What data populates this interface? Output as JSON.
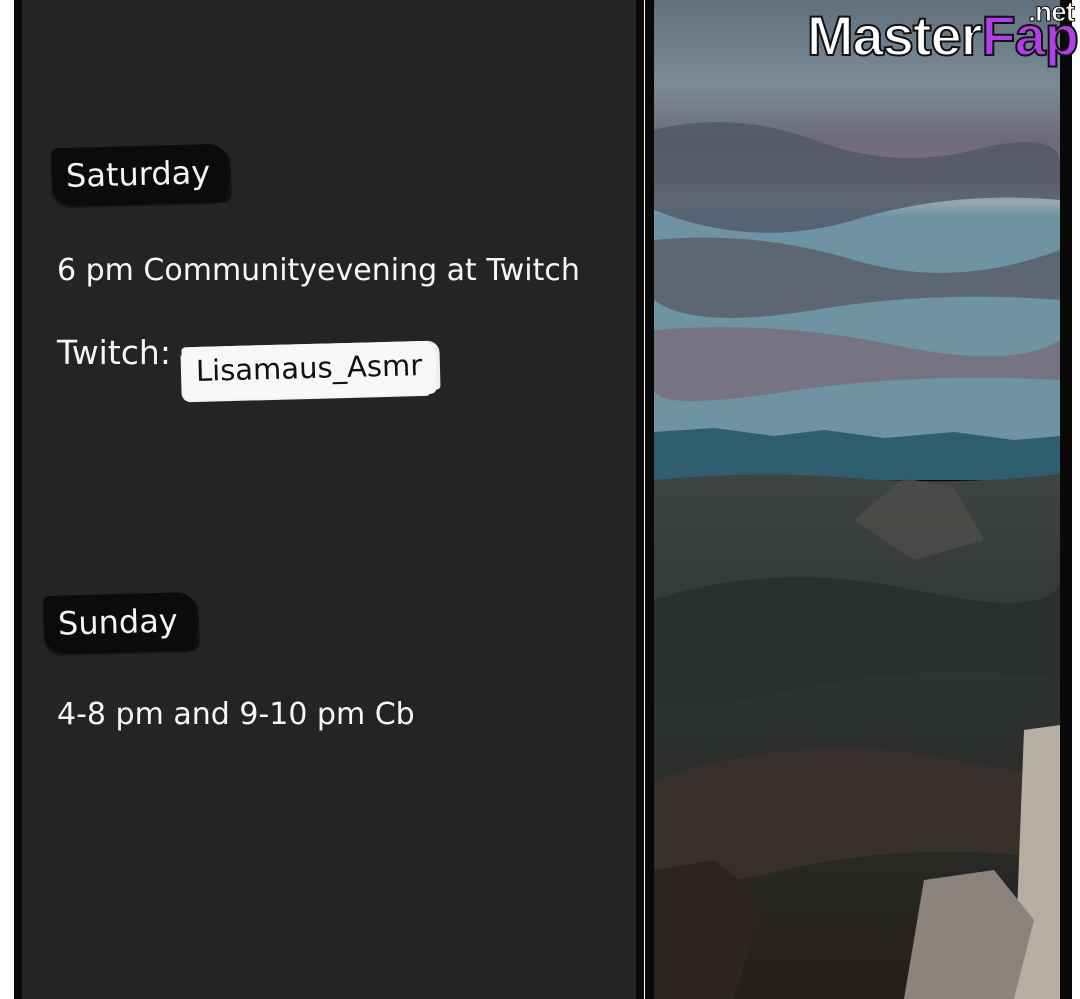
{
  "schedule": {
    "saturday": {
      "day_label": "Saturday",
      "event": "6 pm Communityevening at Twitch",
      "platform_label": "Twitch:",
      "handle": "Lisamaus_Asmr"
    },
    "sunday": {
      "day_label": "Sunday",
      "event": "4-8 pm and 9-10 pm Cb"
    }
  },
  "watermark": {
    "brand_part1": "Master",
    "brand_part2": "Fap",
    "tld": ".net",
    "accent_color": "#b13ee8"
  },
  "colors": {
    "panel_background": "#242424",
    "label_background": "#0b0b0b",
    "text": "#f6f6f6"
  }
}
